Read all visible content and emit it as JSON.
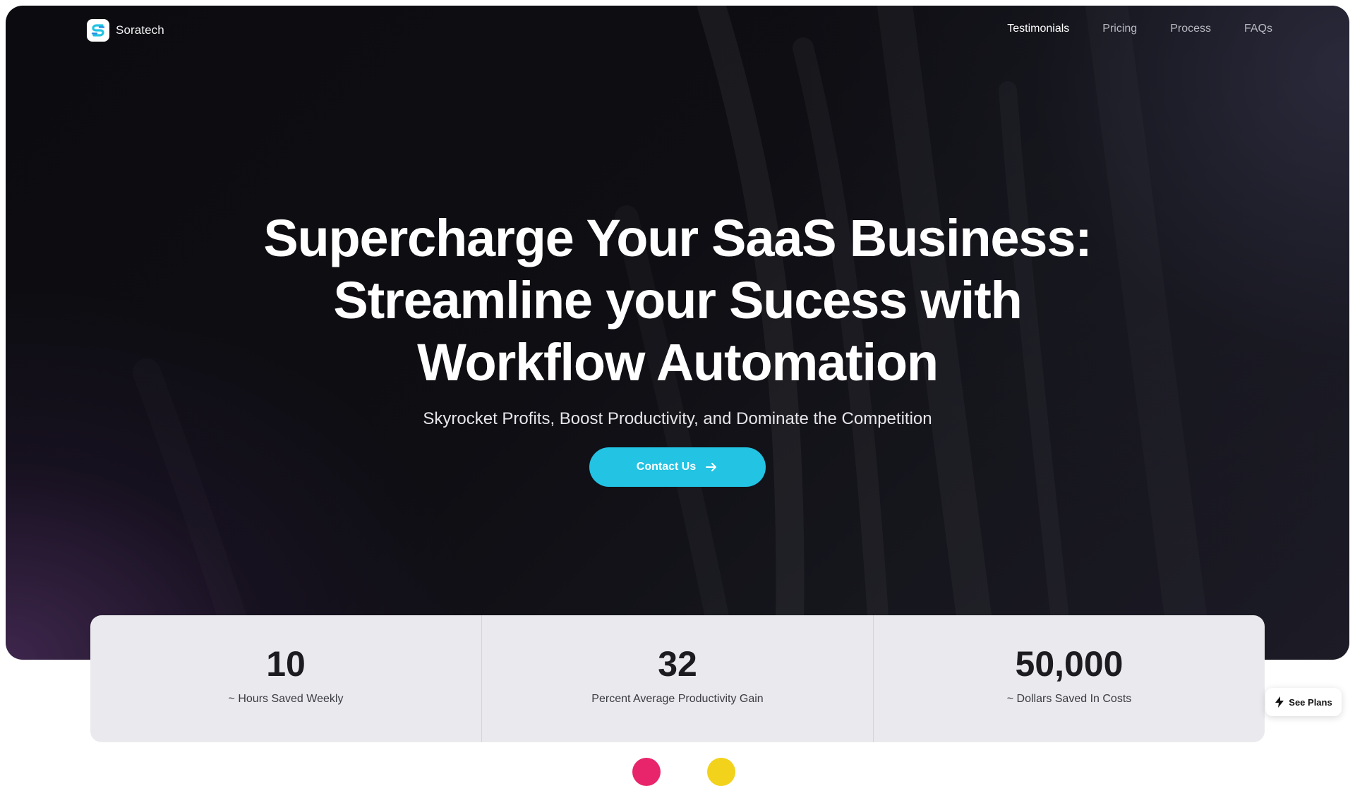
{
  "brand": {
    "name": "Soratech",
    "logo_icon": "soratech-logo-icon"
  },
  "nav": {
    "links": [
      {
        "label": "Testimonials",
        "active": true
      },
      {
        "label": "Pricing",
        "active": false
      },
      {
        "label": "Process",
        "active": false
      },
      {
        "label": "FAQs",
        "active": false
      }
    ]
  },
  "hero": {
    "headline_lines": [
      "Supercharge Your SaaS Business:",
      "Streamline your Sucess with",
      "Workflow Automation"
    ],
    "subheadline": "Skyrocket Profits, Boost Productivity, and Dominate the Competition",
    "cta_label": "Contact Us",
    "cta_icon": "arrow-right-icon",
    "accent_color": "#22c3e3"
  },
  "stats": [
    {
      "value": "10",
      "label": "~ Hours Saved Weekly"
    },
    {
      "value": "32",
      "label": "Percent Average Productivity Gain"
    },
    {
      "value": "50,000",
      "label": "~ Dollars Saved In Costs"
    }
  ],
  "floating_button": {
    "label": "See Plans",
    "icon": "lightning-icon"
  },
  "colors": {
    "hero_bg": "#0e0e13",
    "stats_bg": "#eaeaee",
    "peek_pink": "#e8246a",
    "peek_yellow": "#f2d21b"
  }
}
